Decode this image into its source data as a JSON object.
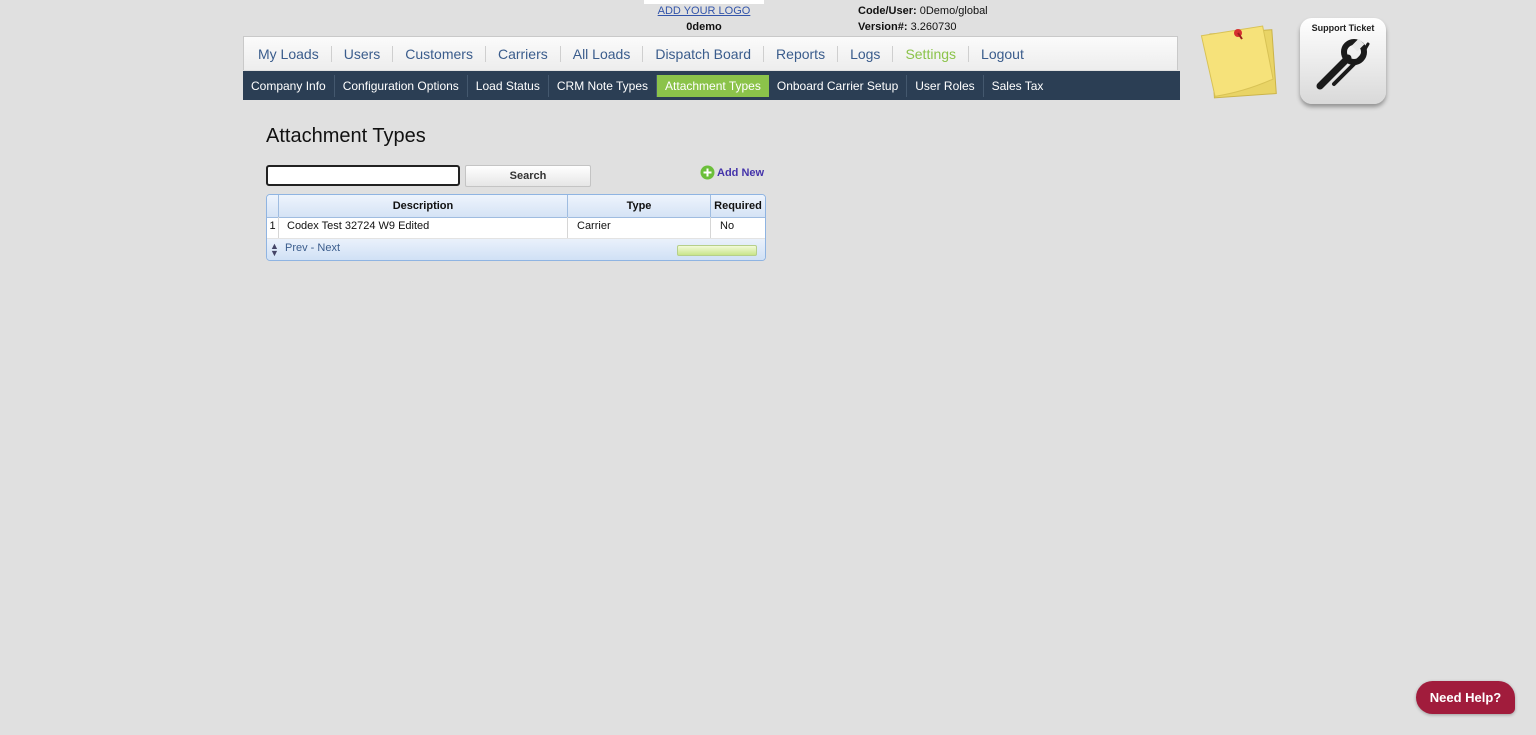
{
  "header": {
    "logo_link": "ADD YOUR LOGO",
    "company": "0demo",
    "code_user_label": "Code/User:",
    "code_user_value": "0Demo/global",
    "version_label": "Version#:",
    "version_value": "3.260730"
  },
  "main_nav": [
    {
      "label": "My Loads"
    },
    {
      "label": "Users"
    },
    {
      "label": "Customers"
    },
    {
      "label": "Carriers"
    },
    {
      "label": "All Loads"
    },
    {
      "label": "Dispatch Board"
    },
    {
      "label": "Reports"
    },
    {
      "label": "Logs"
    },
    {
      "label": "Settings",
      "active": true
    },
    {
      "label": "Logout"
    }
  ],
  "sub_nav": [
    {
      "label": "Company Info"
    },
    {
      "label": "Configuration Options"
    },
    {
      "label": "Load Status"
    },
    {
      "label": "CRM Note Types"
    },
    {
      "label": "Attachment Types",
      "active": true
    },
    {
      "label": "Onboard Carrier Setup"
    },
    {
      "label": "User Roles"
    },
    {
      "label": "Sales Tax"
    }
  ],
  "support": {
    "label": "Support Ticket"
  },
  "page": {
    "title": "Attachment Types",
    "search_value": "",
    "search_button": "Search",
    "add_new": "Add New"
  },
  "grid": {
    "columns": [
      "Description",
      "Type",
      "Required"
    ],
    "rows": [
      {
        "num": "1",
        "description": "Codex Test 32724 W9 Edited",
        "type": "Carrier",
        "required": "No"
      }
    ],
    "pager": "Prev - Next"
  },
  "help": {
    "label": "Need Help?"
  },
  "colors": {
    "accent_green": "#8bc34a",
    "subnav_bg": "#2b3e54",
    "link_blue": "#3a5c8c",
    "help_red": "#a11c3c"
  }
}
